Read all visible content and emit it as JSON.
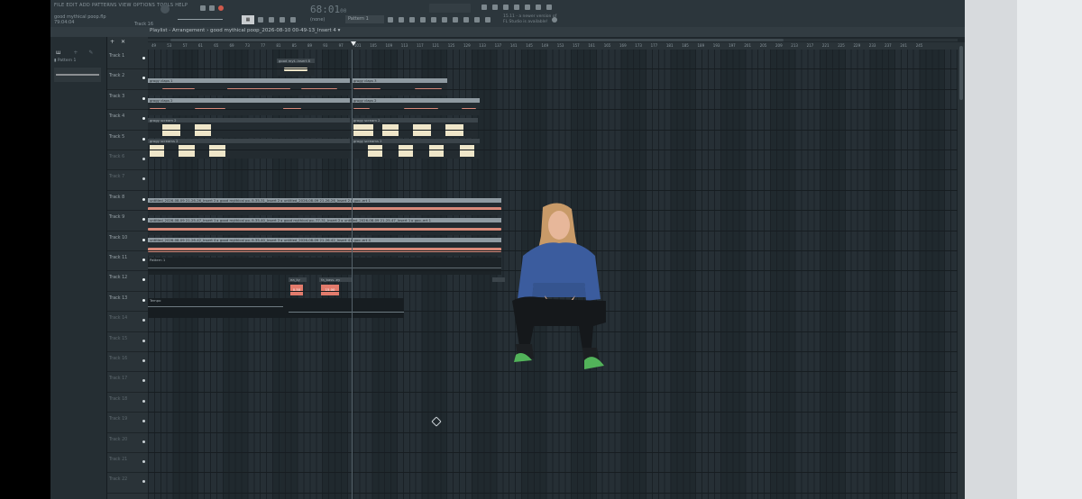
{
  "menu": [
    "FILE",
    "EDIT",
    "ADD",
    "PATTERNS",
    "VIEW",
    "OPTIONS",
    "TOOLS",
    "HELP"
  ],
  "project": {
    "name": "good mythical poop.flp",
    "meta": "79:04:04"
  },
  "transport": {
    "time": "68:01",
    "time_small": "00",
    "bpm": "",
    "track_label": "Track 16",
    "snap": "(none)"
  },
  "pattern_selector": "Pattern 1",
  "news": [
    "15.11 - a newer version of",
    "FL Studio is available!"
  ],
  "playlist": {
    "title": "Playlist - Arrangement",
    "clip_path": "good mythical poop_2026-08-10 00-49-13_Insert 4"
  },
  "browser": {
    "item": "Pattern 1"
  },
  "ruler": [
    "49",
    "53",
    "57",
    "61",
    "65",
    "69",
    "73",
    "77",
    "81",
    "85",
    "89",
    "93",
    "97",
    "101",
    "105",
    "109",
    "113",
    "117",
    "121",
    "125",
    "129",
    "133",
    "137",
    "141",
    "145",
    "149",
    "153",
    "157",
    "161",
    "165",
    "169",
    "173",
    "177",
    "181",
    "185",
    "189",
    "193",
    "197",
    "201",
    "205",
    "209",
    "213",
    "217",
    "221",
    "225",
    "229",
    "233",
    "237",
    "241",
    "245"
  ],
  "tracks": [
    {
      "label": "Track 1",
      "active": true
    },
    {
      "label": "Track 2",
      "active": true
    },
    {
      "label": "Track 3",
      "active": true
    },
    {
      "label": "Track 4",
      "active": true
    },
    {
      "label": "Track 5",
      "active": true
    },
    {
      "label": "Track 6",
      "active": false
    },
    {
      "label": "Track 7",
      "active": false
    },
    {
      "label": "Track 8",
      "active": true
    },
    {
      "label": "Track 9",
      "active": true
    },
    {
      "label": "Track 10",
      "active": true
    },
    {
      "label": "Track 11",
      "active": true
    },
    {
      "label": "Track 12",
      "active": true
    },
    {
      "label": "Track 13",
      "active": true
    },
    {
      "label": "Track 14",
      "active": false
    },
    {
      "label": "Track 15",
      "active": false
    },
    {
      "label": "Track 16",
      "active": false
    },
    {
      "label": "Track 17",
      "active": false
    },
    {
      "label": "Track 18",
      "active": false
    },
    {
      "label": "Track 19",
      "active": false
    },
    {
      "label": "Track 20",
      "active": false
    },
    {
      "label": "Track 21",
      "active": false
    },
    {
      "label": "Track 22",
      "active": false
    }
  ],
  "clips": {
    "t1": "good myt..insert 8",
    "t2a": "grogy claps 1",
    "t2b": "grogy claps 3",
    "t3a": "grogy claps 2",
    "t4a": "grogy scream 2",
    "t4b": "grogy scream 2",
    "t5a": "grogy screams 2",
    "t8": [
      "untitled_2026-08-09 21-26-26_Insert 2",
      "good mythical po..9-35-31_Insert 2",
      "untitled_2026-08-09 21-26-26_Insert 2",
      "goo..ert 1"
    ],
    "t9": [
      "untitled_2026-08-09 21-25-47_Insert 1",
      "good mythical po..9-35-40_Insert 2",
      "good mythical po..77-31_Insert 2",
      "untitled_2026-08-09 21-25-47_Insert 1",
      "goo..ert 1"
    ],
    "t10": [
      "untitled_2026-08-09 21-26-42_Insert 4",
      "good mythical po..9-35-40_Insert 3",
      "untitled_2026-08-09 21-26-42_Insert 4",
      "goo..ert 4"
    ],
    "t11": "Pattern 1",
    "t12a": "ea_ky",
    "t12b": "fa_bass..ey"
  },
  "red_blocks": [
    "0.50",
    "15.00"
  ],
  "automation_label": "Tempo",
  "colors": {
    "waveform": "#d98a7a",
    "transient": "#efe6c9",
    "clip_header": "#8f9aa1",
    "grid_dark": "#1f272c"
  }
}
